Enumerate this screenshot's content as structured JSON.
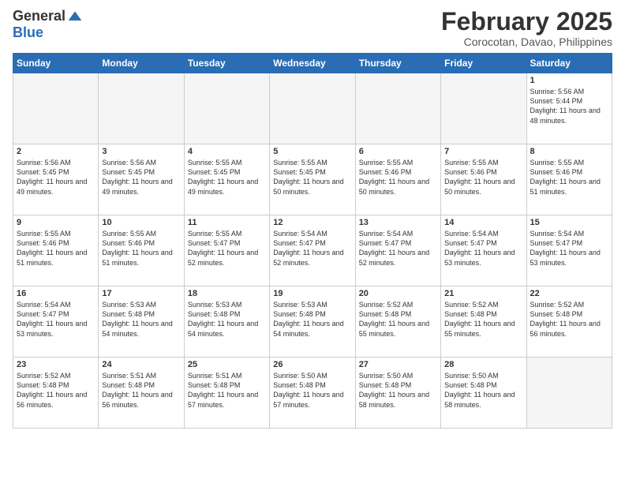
{
  "header": {
    "logo_general": "General",
    "logo_blue": "Blue",
    "month_title": "February 2025",
    "location": "Corocotan, Davao, Philippines"
  },
  "weekdays": [
    "Sunday",
    "Monday",
    "Tuesday",
    "Wednesday",
    "Thursday",
    "Friday",
    "Saturday"
  ],
  "weeks": [
    [
      {
        "day": "",
        "info": ""
      },
      {
        "day": "",
        "info": ""
      },
      {
        "day": "",
        "info": ""
      },
      {
        "day": "",
        "info": ""
      },
      {
        "day": "",
        "info": ""
      },
      {
        "day": "",
        "info": ""
      },
      {
        "day": "1",
        "info": "Sunrise: 5:56 AM\nSunset: 5:44 PM\nDaylight: 11 hours\nand 48 minutes."
      }
    ],
    [
      {
        "day": "2",
        "info": "Sunrise: 5:56 AM\nSunset: 5:45 PM\nDaylight: 11 hours\nand 49 minutes."
      },
      {
        "day": "3",
        "info": "Sunrise: 5:56 AM\nSunset: 5:45 PM\nDaylight: 11 hours\nand 49 minutes."
      },
      {
        "day": "4",
        "info": "Sunrise: 5:55 AM\nSunset: 5:45 PM\nDaylight: 11 hours\nand 49 minutes."
      },
      {
        "day": "5",
        "info": "Sunrise: 5:55 AM\nSunset: 5:45 PM\nDaylight: 11 hours\nand 50 minutes."
      },
      {
        "day": "6",
        "info": "Sunrise: 5:55 AM\nSunset: 5:46 PM\nDaylight: 11 hours\nand 50 minutes."
      },
      {
        "day": "7",
        "info": "Sunrise: 5:55 AM\nSunset: 5:46 PM\nDaylight: 11 hours\nand 50 minutes."
      },
      {
        "day": "8",
        "info": "Sunrise: 5:55 AM\nSunset: 5:46 PM\nDaylight: 11 hours\nand 51 minutes."
      }
    ],
    [
      {
        "day": "9",
        "info": "Sunrise: 5:55 AM\nSunset: 5:46 PM\nDaylight: 11 hours\nand 51 minutes."
      },
      {
        "day": "10",
        "info": "Sunrise: 5:55 AM\nSunset: 5:46 PM\nDaylight: 11 hours\nand 51 minutes."
      },
      {
        "day": "11",
        "info": "Sunrise: 5:55 AM\nSunset: 5:47 PM\nDaylight: 11 hours\nand 52 minutes."
      },
      {
        "day": "12",
        "info": "Sunrise: 5:54 AM\nSunset: 5:47 PM\nDaylight: 11 hours\nand 52 minutes."
      },
      {
        "day": "13",
        "info": "Sunrise: 5:54 AM\nSunset: 5:47 PM\nDaylight: 11 hours\nand 52 minutes."
      },
      {
        "day": "14",
        "info": "Sunrise: 5:54 AM\nSunset: 5:47 PM\nDaylight: 11 hours\nand 53 minutes."
      },
      {
        "day": "15",
        "info": "Sunrise: 5:54 AM\nSunset: 5:47 PM\nDaylight: 11 hours\nand 53 minutes."
      }
    ],
    [
      {
        "day": "16",
        "info": "Sunrise: 5:54 AM\nSunset: 5:47 PM\nDaylight: 11 hours\nand 53 minutes."
      },
      {
        "day": "17",
        "info": "Sunrise: 5:53 AM\nSunset: 5:48 PM\nDaylight: 11 hours\nand 54 minutes."
      },
      {
        "day": "18",
        "info": "Sunrise: 5:53 AM\nSunset: 5:48 PM\nDaylight: 11 hours\nand 54 minutes."
      },
      {
        "day": "19",
        "info": "Sunrise: 5:53 AM\nSunset: 5:48 PM\nDaylight: 11 hours\nand 54 minutes."
      },
      {
        "day": "20",
        "info": "Sunrise: 5:52 AM\nSunset: 5:48 PM\nDaylight: 11 hours\nand 55 minutes."
      },
      {
        "day": "21",
        "info": "Sunrise: 5:52 AM\nSunset: 5:48 PM\nDaylight: 11 hours\nand 55 minutes."
      },
      {
        "day": "22",
        "info": "Sunrise: 5:52 AM\nSunset: 5:48 PM\nDaylight: 11 hours\nand 56 minutes."
      }
    ],
    [
      {
        "day": "23",
        "info": "Sunrise: 5:52 AM\nSunset: 5:48 PM\nDaylight: 11 hours\nand 56 minutes."
      },
      {
        "day": "24",
        "info": "Sunrise: 5:51 AM\nSunset: 5:48 PM\nDaylight: 11 hours\nand 56 minutes."
      },
      {
        "day": "25",
        "info": "Sunrise: 5:51 AM\nSunset: 5:48 PM\nDaylight: 11 hours\nand 57 minutes."
      },
      {
        "day": "26",
        "info": "Sunrise: 5:50 AM\nSunset: 5:48 PM\nDaylight: 11 hours\nand 57 minutes."
      },
      {
        "day": "27",
        "info": "Sunrise: 5:50 AM\nSunset: 5:48 PM\nDaylight: 11 hours\nand 58 minutes."
      },
      {
        "day": "28",
        "info": "Sunrise: 5:50 AM\nSunset: 5:48 PM\nDaylight: 11 hours\nand 58 minutes."
      },
      {
        "day": "",
        "info": ""
      }
    ]
  ]
}
